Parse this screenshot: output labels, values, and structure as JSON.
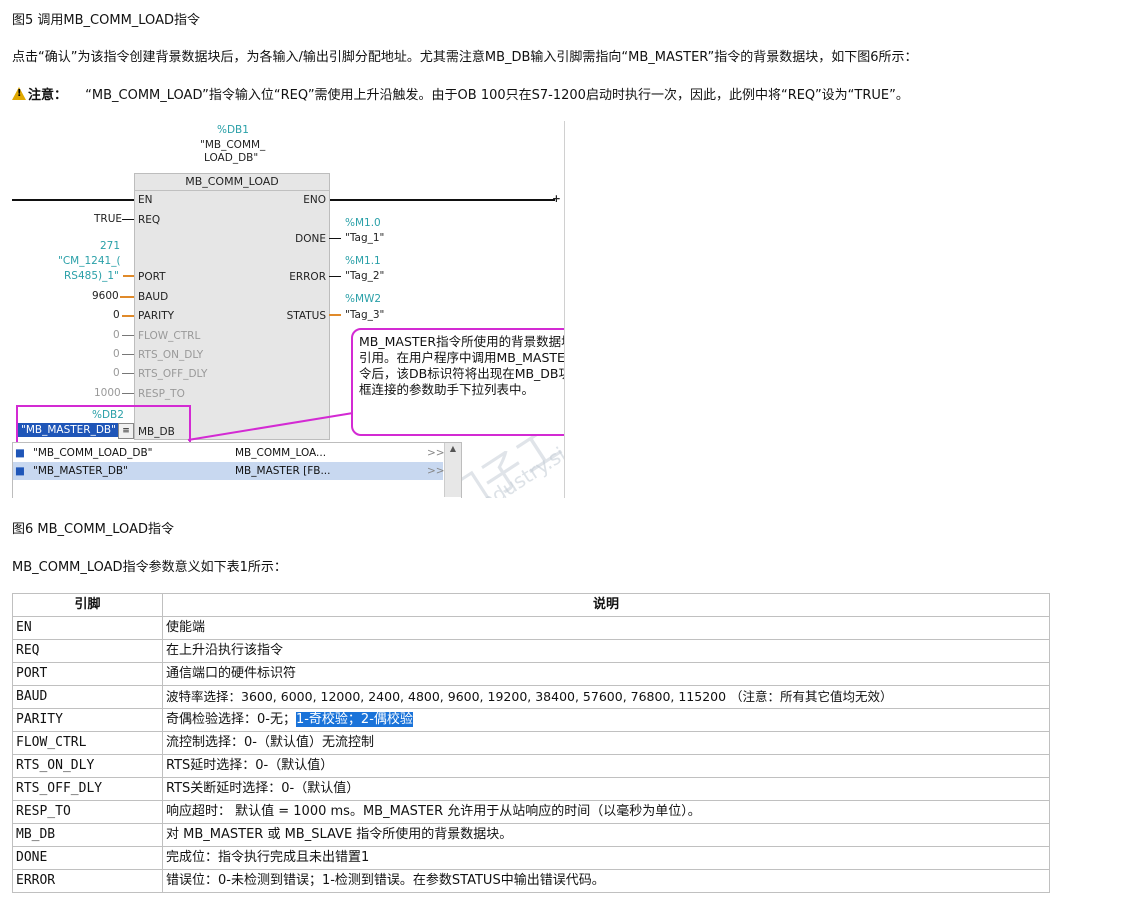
{
  "doc": {
    "fig5_caption": "图5 调用MB_COMM_LOAD指令",
    "para1": "点击“确认”为该指令创建背景数据块后，为各输入/输出引脚分配地址。尤其需注意MB_DB输入引脚需指向“MB_MASTER”指令的背景数据块，如下图6所示：",
    "note_label": "注意：",
    "note_text": "“MB_COMM_LOAD”指令输入位“REQ”需使用上升沿触发。由于OB 100只在S7-1200启动时执行一次，因此，此例中将“REQ”设为“TRUE”。",
    "fig6_caption": "图6 MB_COMM_LOAD指令",
    "table_intro": "MB_COMM_LOAD指令参数意义如下表1所示："
  },
  "diagram": {
    "db1_addr": "%DB1",
    "db1_name1": "\"MB_COMM_",
    "db1_name2": "LOAD_DB\"",
    "block_title": "MB_COMM_LOAD",
    "en": "EN",
    "eno": "ENO",
    "req_val": "TRUE",
    "req": "REQ",
    "port_val1": "271",
    "port_val2": "\"CM_1241_(",
    "port_val3": "RS485)_1\"",
    "port": "PORT",
    "baud_val": "9600",
    "baud": "BAUD",
    "parity_val": "0",
    "parity": "PARITY",
    "flow_val": "0",
    "flow": "FLOW_CTRL",
    "rtson_val": "0",
    "rtson": "RTS_ON_DLY",
    "rtsoff_val": "0",
    "rtsoff": "RTS_OFF_DLY",
    "resp_val": "1000",
    "resp": "RESP_TO",
    "db2_addr": "%DB2",
    "mbdb_val": "\"MB_MASTER_DB\"",
    "mbdb": "MB_DB",
    "done": "DONE",
    "done_addr": "%M1.0",
    "done_tag": "\"Tag_1\"",
    "error": "ERROR",
    "error_addr": "%M1.1",
    "error_tag": "\"Tag_2\"",
    "status": "STATUS",
    "status_addr": "%MW2",
    "status_tag": "\"Tag_3\"",
    "callout": "MB_MASTER指令所使用的背景数据块的引用。在用户程序中调用MB_MASTER指令后，该DB标识符将出现在MB_DB功能框连接的参数助手下拉列表中。",
    "dropdown": [
      {
        "name": "\"MB_COMM_LOAD_DB\"",
        "type": "MB_COMM_LOA...",
        "more": ">>"
      },
      {
        "name": "\"MB_MASTER_DB\"",
        "type": "MB_MASTER [FB...",
        "more": ">>"
      }
    ],
    "watermark_cn": "西门子工业  技术论坛",
    "watermark_en": "support.industry.siemens.com/cs"
  },
  "table": {
    "headers": [
      "引脚",
      "说明"
    ],
    "rows": [
      [
        "EN",
        "使能端"
      ],
      [
        "REQ",
        "在上升沿执行该指令"
      ],
      [
        "PORT",
        "通信端口的硬件标识符"
      ],
      [
        "BAUD",
        "波特率选择：3600, 6000, 12000, 2400, 4800, 9600, 19200, 38400, 57600, 76800, 115200 （注意：所有其它值均无效）"
      ],
      [
        "PARITY",
        "奇偶检验选择：0-无；",
        "1-奇校验；2-偶校验"
      ],
      [
        "FLOW_CTRL",
        "流控制选择：0-（默认值）无流控制"
      ],
      [
        "RTS_ON_DLY",
        "RTS延时选择：0-（默认值）"
      ],
      [
        "RTS_OFF_DLY",
        "RTS关断延时选择：0-（默认值）"
      ],
      [
        "RESP_TO",
        "响应超时： 默认值 = 1000 ms。MB_MASTER 允许用于从站响应的时间（以毫秒为单位）。"
      ],
      [
        "MB_DB",
        "对 MB_MASTER 或 MB_SLAVE 指令所使用的背景数据块。"
      ],
      [
        "DONE",
        "完成位：指令执行完成且未出错置1"
      ],
      [
        "ERROR",
        "错误位：0-未检测到错误；1-检测到错误。在参数STATUS中输出错误代码。"
      ]
    ]
  }
}
